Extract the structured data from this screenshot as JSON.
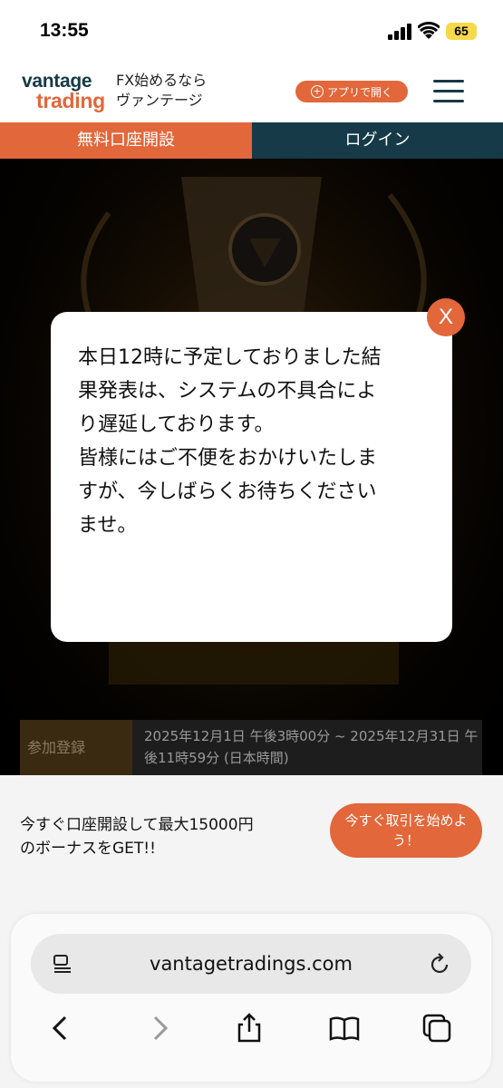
{
  "status_bar": {
    "time": "13:55",
    "battery": "65"
  },
  "header": {
    "logo_line1": "vantage",
    "logo_line2": "trading",
    "tagline_line1": "FX始めるなら",
    "tagline_line2": "ヴァンテージ",
    "app_button": "アプリで開く"
  },
  "nav": {
    "open_account": "無料口座開設",
    "login": "ログイン"
  },
  "info": {
    "label": "参加登録",
    "value": "2025年12月1日 午後3時00分 ~ 2025年12月31日 午後11時59分 (日本時間)"
  },
  "modal": {
    "close_label": "X",
    "message": "本日12時に予定しておりました結\n果発表は、システムの不具合によ\nり遅延しております。\n皆様にはご不便をおかけいたしま\nすが、今しばらくお待ちください\nませ。"
  },
  "promo": {
    "text": "今すぐ口座開設して最大15000円\nのボーナスをGET!!",
    "button": "今すぐ取引を始めよう！"
  },
  "browser": {
    "url": "vantagetradings.com"
  },
  "colors": {
    "accent": "#e2673a",
    "navy": "#163a47"
  }
}
